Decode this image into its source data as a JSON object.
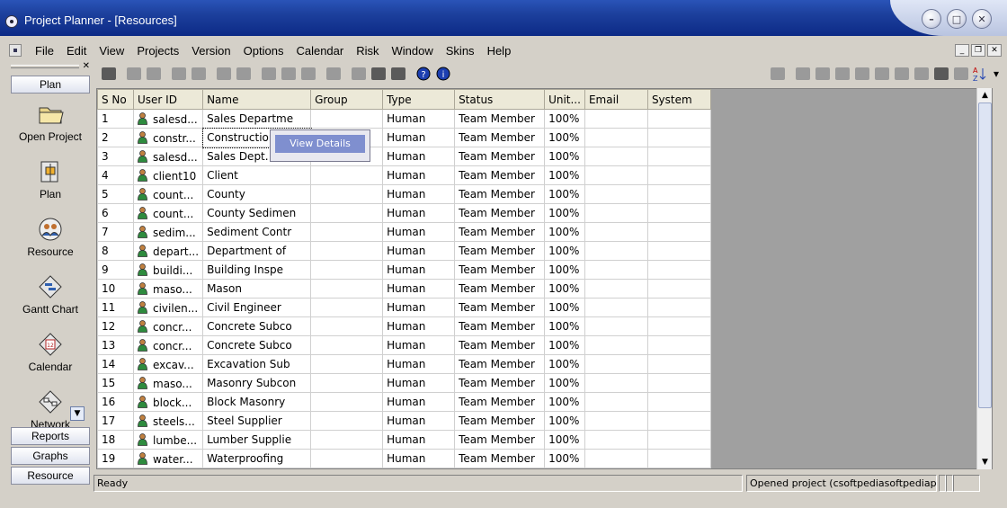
{
  "window": {
    "title": "Project Planner - [Resources]"
  },
  "menu": [
    "File",
    "Edit",
    "View",
    "Projects",
    "Version",
    "Options",
    "Calendar",
    "Risk",
    "Window",
    "Skins",
    "Help"
  ],
  "nav": {
    "top_tab": "Plan",
    "items": [
      "Open Project",
      "Plan",
      "Resource",
      "Gantt Chart",
      "Calendar",
      "Network Diagram"
    ],
    "bottom_tabs": [
      "Reports",
      "Graphs",
      "Resource"
    ]
  },
  "grid": {
    "columns": [
      "S No",
      "User ID",
      "Name",
      "Group",
      "Type",
      "Status",
      "Unit...",
      "Email",
      "System"
    ],
    "rows": [
      [
        "1",
        "salesd...",
        "Sales Departme",
        "",
        "Human",
        "Team Member",
        "100%",
        "",
        ""
      ],
      [
        "2",
        "constr...",
        "Construction D",
        "",
        "Human",
        "Team Member",
        "100%",
        "",
        ""
      ],
      [
        "3",
        "salesd...",
        "Sales Dept.",
        "",
        "Human",
        "Team Member",
        "100%",
        "",
        ""
      ],
      [
        "4",
        "client10",
        "Client",
        "",
        "Human",
        "Team Member",
        "100%",
        "",
        ""
      ],
      [
        "5",
        "count...",
        "County",
        "",
        "Human",
        "Team Member",
        "100%",
        "",
        ""
      ],
      [
        "6",
        "count...",
        "County Sedimen",
        "",
        "Human",
        "Team Member",
        "100%",
        "",
        ""
      ],
      [
        "7",
        "sedim...",
        "Sediment Contr",
        "",
        "Human",
        "Team Member",
        "100%",
        "",
        ""
      ],
      [
        "8",
        "depart...",
        "Department of",
        "",
        "Human",
        "Team Member",
        "100%",
        "",
        ""
      ],
      [
        "9",
        "buildi...",
        "Building Inspe",
        "",
        "Human",
        "Team Member",
        "100%",
        "",
        ""
      ],
      [
        "10",
        "maso...",
        "Mason",
        "",
        "Human",
        "Team Member",
        "100%",
        "",
        ""
      ],
      [
        "11",
        "civilen...",
        "Civil Engineer",
        "",
        "Human",
        "Team Member",
        "100%",
        "",
        ""
      ],
      [
        "12",
        "concr...",
        "Concrete Subco",
        "",
        "Human",
        "Team Member",
        "100%",
        "",
        ""
      ],
      [
        "13",
        "concr...",
        "Concrete Subco",
        "",
        "Human",
        "Team Member",
        "100%",
        "",
        ""
      ],
      [
        "14",
        "excav...",
        "Excavation Sub",
        "",
        "Human",
        "Team Member",
        "100%",
        "",
        ""
      ],
      [
        "15",
        "maso...",
        "Masonry Subcon",
        "",
        "Human",
        "Team Member",
        "100%",
        "",
        ""
      ],
      [
        "16",
        "block...",
        "Block Masonry",
        "",
        "Human",
        "Team Member",
        "100%",
        "",
        ""
      ],
      [
        "17",
        "steels...",
        "Steel Supplier",
        "",
        "Human",
        "Team Member",
        "100%",
        "",
        ""
      ],
      [
        "18",
        "lumbe...",
        "Lumber Supplie",
        "",
        "Human",
        "Team Member",
        "100%",
        "",
        ""
      ],
      [
        "19",
        "water...",
        "Waterproofing",
        "",
        "Human",
        "Team Member",
        "100%",
        "",
        ""
      ]
    ]
  },
  "context_menu": {
    "item": "View Details"
  },
  "status": {
    "left": "Ready",
    "right": "Opened project (csoftpediasoftpediaproject."
  }
}
